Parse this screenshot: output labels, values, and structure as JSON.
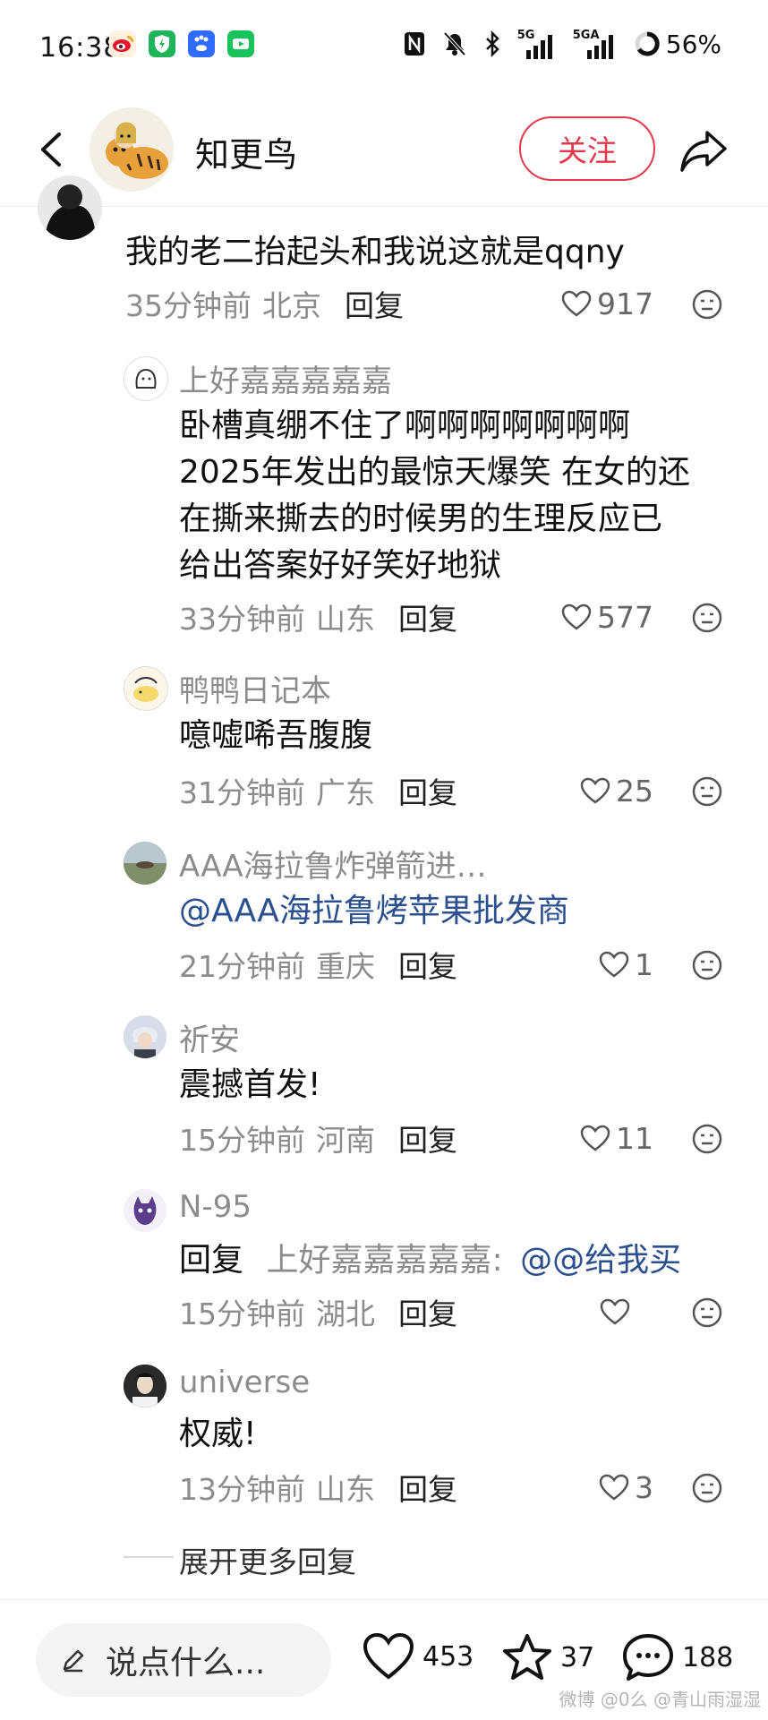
{
  "status_bar": {
    "time": "16:38",
    "network_1": "5G",
    "network_2": "5GA",
    "battery": "56%",
    "app_icons": [
      "weibo-icon",
      "security-shield-icon",
      "baidu-icon",
      "video-app-icon"
    ]
  },
  "header": {
    "author_name": "知更鸟",
    "follow_label": "关注"
  },
  "comments": [
    {
      "text": "我的老二抬起头和我说这就是qqny",
      "time": "35分钟前",
      "location": "北京",
      "reply_label": "回复",
      "likes": "917"
    },
    {
      "username": "上好嘉嘉嘉嘉嘉",
      "lines": [
        "卧槽真绷不住了啊啊啊啊啊啊啊",
        "2025年发出的最惊天爆笑 在女的还",
        "在撕来撕去的时候男的生理反应已",
        "给出答案好好笑好地狱"
      ],
      "time": "33分钟前",
      "location": "山东",
      "reply_label": "回复",
      "likes": "577"
    },
    {
      "username": "鸭鸭日记本",
      "text": "噫嘘唏吾腹腹",
      "time": "31分钟前",
      "location": "广东",
      "reply_label": "回复",
      "likes": "25"
    },
    {
      "username": "AAA海拉鲁炸弹箭进…",
      "text": "@AAA海拉鲁烤苹果批发商",
      "time": "21分钟前",
      "location": "重庆",
      "reply_label": "回复",
      "likes": "1"
    },
    {
      "username": "祈安",
      "text": "震撼首发!",
      "time": "15分钟前",
      "location": "河南",
      "reply_label": "回复",
      "likes": "11"
    },
    {
      "username": "N-95",
      "text_prefix": "回复",
      "reply_to": "上好嘉嘉嘉嘉嘉:",
      "text_mention": "@@给我买",
      "time": "15分钟前",
      "location": "湖北",
      "reply_label": "回复",
      "likes": ""
    },
    {
      "username": "universe",
      "text": "权威!",
      "time": "13分钟前",
      "location": "山东",
      "reply_label": "回复",
      "likes": "3"
    }
  ],
  "expand_label": "展开更多回复",
  "bottom_bar": {
    "input_placeholder": "说点什么...",
    "likes_count": "453",
    "favorites_count": "37",
    "comments_count": "188"
  },
  "watermark": "微博 @0么 @青山雨湿湿"
}
